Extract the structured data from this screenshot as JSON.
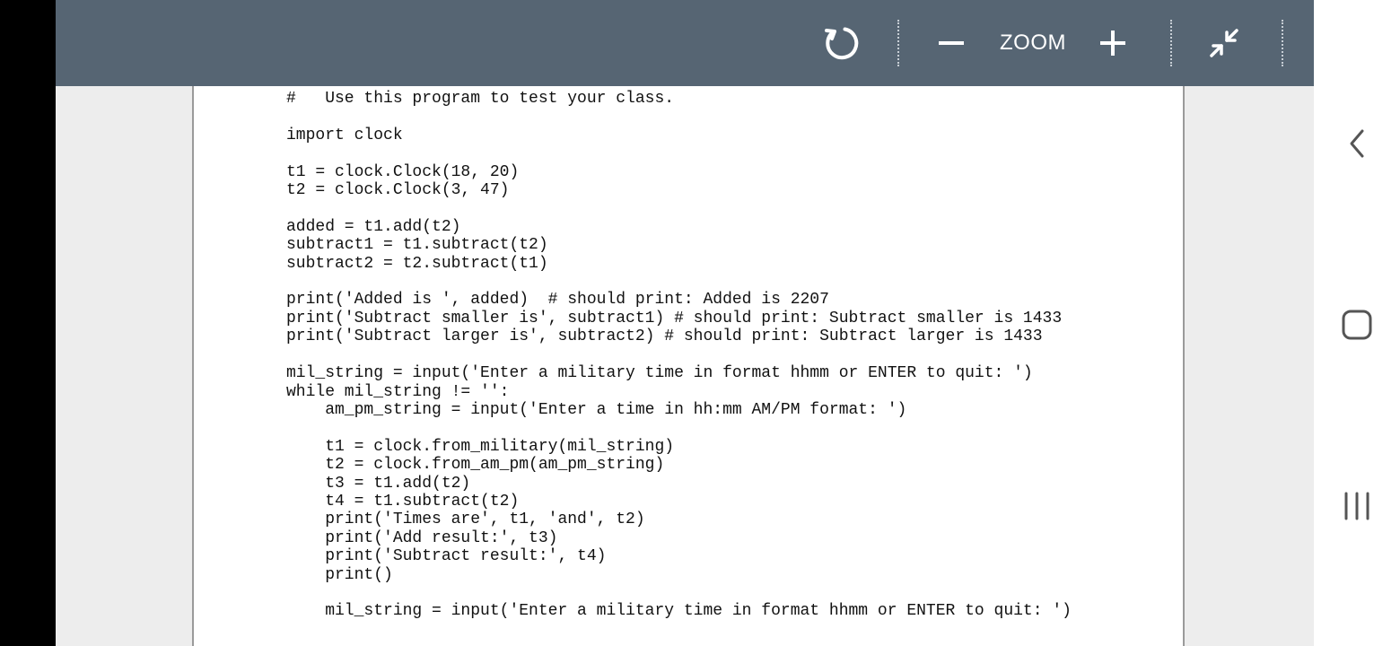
{
  "toolbar": {
    "refresh_icon": "refresh-icon",
    "zoom_out_icon": "minus-icon",
    "zoom_label": "ZOOM",
    "zoom_in_icon": "plus-icon",
    "collapse_icon": "collapse-icon"
  },
  "document": {
    "code_lines": [
      "#   Use this program to test your class.",
      "",
      "import clock",
      "",
      "t1 = clock.Clock(18, 20)",
      "t2 = clock.Clock(3, 47)",
      "",
      "added = t1.add(t2)",
      "subtract1 = t1.subtract(t2)",
      "subtract2 = t2.subtract(t1)",
      "",
      "print('Added is ', added)  # should print: Added is 2207",
      "print('Subtract smaller is', subtract1) # should print: Subtract smaller is 1433",
      "print('Subtract larger is', subtract2) # should print: Subtract larger is 1433",
      "",
      "mil_string = input('Enter a military time in format hhmm or ENTER to quit: ')",
      "while mil_string != '':",
      "    am_pm_string = input('Enter a time in hh:mm AM/PM format: ')",
      "",
      "    t1 = clock.from_military(mil_string)",
      "    t2 = clock.from_am_pm(am_pm_string)",
      "    t3 = t1.add(t2)",
      "    t4 = t1.subtract(t2)",
      "    print('Times are', t1, 'and', t2)",
      "    print('Add result:', t3)",
      "    print('Subtract result:', t4)",
      "    print()",
      "",
      "    mil_string = input('Enter a military time in format hhmm or ENTER to quit: ')"
    ]
  },
  "nav": {
    "back_icon": "back-icon",
    "home_icon": "home-icon",
    "recents_icon": "recents-icon"
  },
  "colors": {
    "toolbar_bg": "#566573",
    "viewer_bg": "#ededed",
    "page_bg": "#ffffff"
  }
}
